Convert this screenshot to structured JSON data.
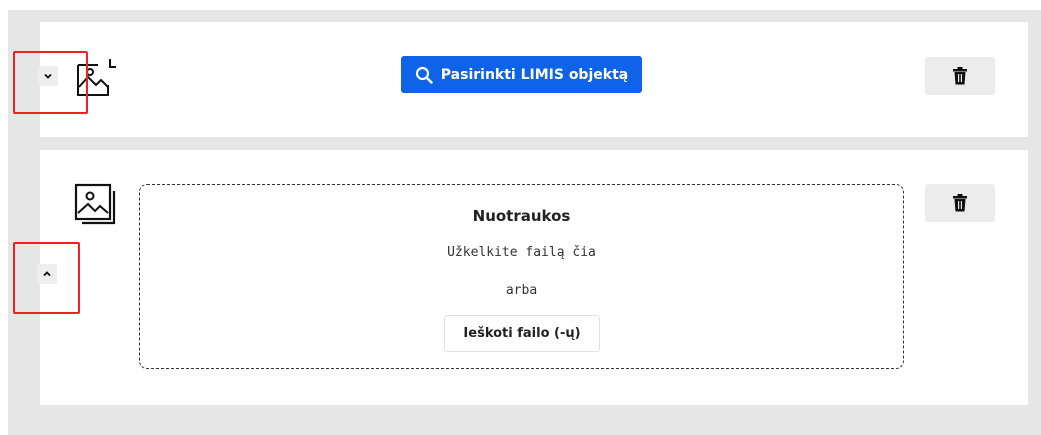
{
  "top_block": {
    "select_button_label": "Pasirinkti LIMIS objektą",
    "collapse_icon": "chevron-down-icon",
    "image_icon": "image-icon",
    "delete_icon": "trash-icon"
  },
  "bottom_block": {
    "expand_icon": "chevron-up-icon",
    "image_icon": "image-gallery-icon",
    "delete_icon": "trash-icon",
    "dropzone": {
      "title": "Nuotraukos",
      "hint": "Užkelkite failą čia",
      "or": "arba",
      "browse_label": "Ieškoti failo (-ų)"
    }
  },
  "colors": {
    "primary": "#0f63e8",
    "highlight": "#ee2222",
    "background": "#e6e6e6"
  }
}
